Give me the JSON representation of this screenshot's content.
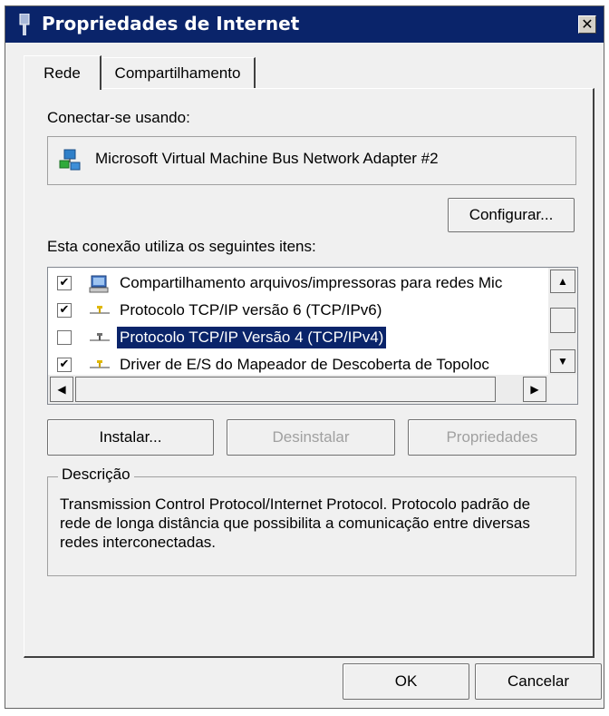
{
  "window": {
    "title": "Propriedades de Internet",
    "close_glyph": "✕"
  },
  "tabs": [
    {
      "label": "Rede",
      "active": true
    },
    {
      "label": "Compartilhamento",
      "active": false
    }
  ],
  "connect_using": {
    "label": "Conectar-se usando:",
    "adapter_name": "Microsoft Virtual Machine Bus Network Adapter #2",
    "adapter_icon": "network-adapter-icon",
    "configure_button": "Configurar..."
  },
  "items_section": {
    "label": "Esta conexão utiliza os seguintes itens:",
    "items": [
      {
        "label": "Compartilhamento arquivos/impressoras para redes Mic",
        "checked": true,
        "checkmark": "✔",
        "icon": "file-printer-sharing-icon",
        "selected": false
      },
      {
        "label": "Protocolo TCP/IP versão 6 (TCP/IPv6)",
        "checked": true,
        "checkmark": "✔",
        "icon": "protocol-icon",
        "selected": false
      },
      {
        "label": "Protocolo TCP/IP Versão 4 (TCP/IPv4)",
        "checked": false,
        "checkmark": "",
        "icon": "protocol-icon",
        "selected": true
      },
      {
        "label": "Driver de E/S do Mapeador de Descoberta de Topoloc",
        "checked": true,
        "checkmark": "✔",
        "icon": "protocol-icon",
        "selected": false
      }
    ]
  },
  "buttons": {
    "install": "Instalar...",
    "uninstall": "Desinstalar",
    "properties": "Propriedades"
  },
  "description": {
    "legend": "Descrição",
    "text": "Transmission Control Protocol/Internet Protocol. Protocolo padrão de rede de longa distância que possibilita a comunicação entre diversas redes interconectadas."
  },
  "footer": {
    "ok": "OK",
    "cancel": "Cancelar"
  },
  "colors": {
    "title_bar": "#0a246a",
    "selection": "#0a246a",
    "dialog_bg": "#f0f0f0"
  }
}
